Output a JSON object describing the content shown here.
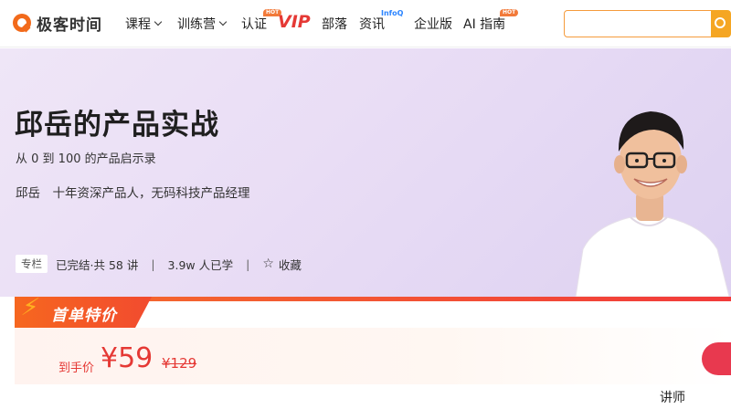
{
  "brand": {
    "name": "极客时间",
    "accent": "#f26a1b"
  },
  "nav": {
    "courses": "课程",
    "bootcamp": "训练营",
    "certification": "认证",
    "cert_badge": "HOT",
    "vip": "VIP",
    "tribe": "部落",
    "news": "资讯",
    "news_badge": "InfoQ",
    "enterprise": "企业版",
    "ai_guide": "AI 指南",
    "ai_badge": "HOT"
  },
  "search": {
    "placeholder": "",
    "button_color": "#f5a623"
  },
  "course": {
    "title": "邱岳的产品实战",
    "subtitle": "从 0 到 100 的产品启示录",
    "author": "邱岳　十年资深产品人，无码科技产品经理",
    "tag": "专栏",
    "status": "已完结·共 58 讲",
    "learners": "3.9w 人已学",
    "separator": "|",
    "favorite": "收藏",
    "hero_bg": "#e9ddf5"
  },
  "promo": {
    "title": "首单特价",
    "price_label": "到手价",
    "price": "¥59",
    "original_price": "¥129",
    "price_color": "#e53935"
  },
  "tabs": {
    "lecturer": "讲师"
  }
}
